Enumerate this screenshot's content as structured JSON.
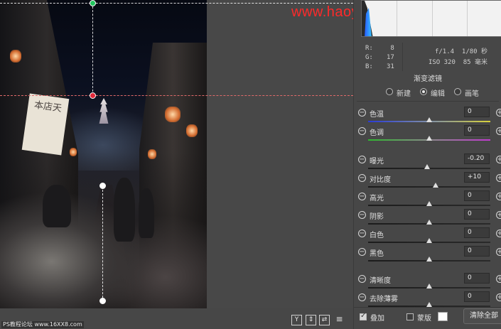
{
  "watermark": "www.haoyudiansheji.com",
  "footer_credit": "PS教程论坛 www.16XX8.com",
  "photo": {
    "banner_text": "本店天"
  },
  "toolbar_icons": [
    "y-icon",
    "flip-icon",
    "swap-icon",
    "adjust-icon"
  ],
  "toolbar_labels": [
    "Y",
    "⇕",
    "⇄",
    "≡"
  ],
  "readout": {
    "r_label": "R:",
    "r_value": "8",
    "g_label": "G:",
    "g_value": "17",
    "b_label": "B:",
    "b_value": "31",
    "aperture": "f/1.4",
    "shutter": "1/80 秒",
    "iso": "ISO 320",
    "focal": "85 毫米"
  },
  "panel": {
    "title": "渐变滤镜",
    "modes": [
      {
        "label": "新建",
        "selected": false
      },
      {
        "label": "编辑",
        "selected": true
      },
      {
        "label": "画笔",
        "selected": false
      }
    ]
  },
  "sliders": [
    {
      "label": "色温",
      "value": "0",
      "position": 0.5,
      "gradient": "temp"
    },
    {
      "label": "色调",
      "value": "0",
      "position": 0.5,
      "gradient": "tint"
    },
    {
      "label": "曝光",
      "value": "-0.20",
      "position": 0.48,
      "gradient": "plain"
    },
    {
      "label": "对比度",
      "value": "+10",
      "position": 0.55,
      "gradient": "plain"
    },
    {
      "label": "高光",
      "value": "0",
      "position": 0.5,
      "gradient": "plain"
    },
    {
      "label": "阴影",
      "value": "0",
      "position": 0.5,
      "gradient": "plain"
    },
    {
      "label": "白色",
      "value": "0",
      "position": 0.5,
      "gradient": "plain"
    },
    {
      "label": "黑色",
      "value": "0",
      "position": 0.5,
      "gradient": "plain"
    },
    {
      "label": "清晰度",
      "value": "0",
      "position": 0.5,
      "gradient": "plain"
    },
    {
      "label": "去除薄雾",
      "value": "0",
      "position": 0.5,
      "gradient": "plain"
    }
  ],
  "bottom": {
    "overlay_label": "叠加",
    "overlay_checked": true,
    "mask_label": "蒙版",
    "mask_checked": false,
    "clear_all_label": "清除全部"
  },
  "colors": {
    "guide_red": "#e06a6a",
    "pin_green": "#22c55e",
    "pin_red": "#e0283a",
    "watermark": "#ff2a2a"
  }
}
